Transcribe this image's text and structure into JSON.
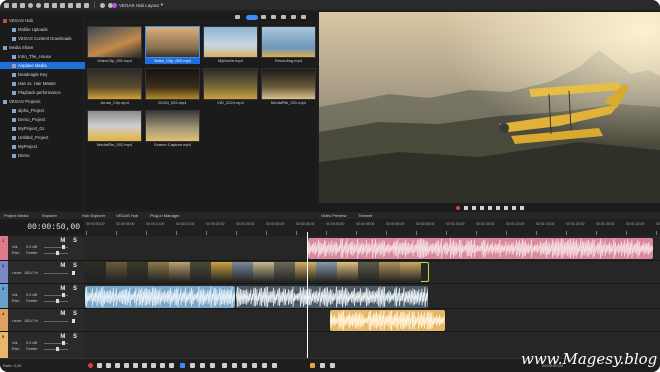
{
  "app": {
    "layout_title": "VEGAS Hub Layout",
    "accent": "#3b8cff",
    "brand": "#b25ad6"
  },
  "toolbar_icons": [
    "new-icon",
    "open-icon",
    "save-icon",
    "settings-icon",
    "gear-icon",
    "render-icon",
    "project-icon",
    "cut-icon",
    "copy-icon",
    "paste-icon",
    "delete-icon",
    "undo-icon",
    "redo-icon",
    "tools-icon"
  ],
  "tree": {
    "items": [
      {
        "label": "VEGAS Hub",
        "indent": 0,
        "icon": "hub-icon"
      },
      {
        "label": "Mobile Uploads",
        "indent": 1,
        "icon": "folder-icon"
      },
      {
        "label": "VEGAS Content Downloads",
        "indent": 1,
        "icon": "folder-icon"
      },
      {
        "label": "Media Share",
        "indent": 0,
        "icon": "folder-icon"
      },
      {
        "label": "Intro_The_House",
        "indent": 1,
        "icon": "folder-icon"
      },
      {
        "label": "Airplane Media",
        "indent": 1,
        "icon": "folder-icon",
        "selected": true
      },
      {
        "label": "Deadeagle Key",
        "indent": 1,
        "icon": "folder-icon"
      },
      {
        "label": "Hair vs. Hair Master",
        "indent": 1,
        "icon": "folder-icon"
      },
      {
        "label": "Playback performance",
        "indent": 1,
        "icon": "folder-icon"
      },
      {
        "label": "VEGAS Projects",
        "indent": 0,
        "icon": "folder-icon"
      },
      {
        "label": "alpha_Project",
        "indent": 1,
        "icon": "project-icon"
      },
      {
        "label": "Demo_Project",
        "indent": 1,
        "icon": "project-icon"
      },
      {
        "label": "MyProject_01",
        "indent": 1,
        "icon": "project-icon"
      },
      {
        "label": "Untitled_Project",
        "indent": 1,
        "icon": "project-icon"
      },
      {
        "label": "MyProject",
        "indent": 1,
        "icon": "project-icon"
      },
      {
        "label": "Demo",
        "indent": 1,
        "icon": "project-icon"
      }
    ]
  },
  "media": [
    {
      "caption": "VideoClip_001.mp4",
      "scene": "dusk"
    },
    {
      "caption": "Video_Clip_002.mp4",
      "scene": "sunset",
      "selected": true
    },
    {
      "caption": "MyMovie.mp4",
      "scene": "sky"
    },
    {
      "caption": "Recording.mp4",
      "scene": "plane-sky"
    },
    {
      "caption": "Jenas_Clip.mp4",
      "scene": "hangar"
    },
    {
      "caption": "DCIM_003.mp4",
      "scene": "dark-plane"
    },
    {
      "caption": "VID_2024.mp4",
      "scene": "ground"
    },
    {
      "caption": "MediaFile_001.mp4",
      "scene": "pilot"
    },
    {
      "caption": "MediaFile_002.mp4",
      "scene": "plane-yellow"
    },
    {
      "caption": "Screen Capture.mp4",
      "scene": "hangar-light"
    }
  ],
  "tabs": [
    "Project Media",
    "Explorer",
    "Hub Explorer",
    "VEGAS Hub",
    "Plug-In Manager",
    "Video Preview",
    "Trimmer"
  ],
  "timeline": {
    "timecode": "00:00:50,00",
    "ruler": [
      "00:00:00;00",
      "00:00:05;00",
      "00:00:10;00",
      "00:00:15;00",
      "00:00:20;00",
      "00:00:25;00",
      "00:00:30;00",
      "00:00:35;00",
      "00:00:40;00",
      "00:00:45;00",
      "00:00:50;00",
      "00:00:55;00",
      "00:01:00;00",
      "00:01:05;00",
      "00:01:10;00",
      "00:01:15;00",
      "00:01:20;00",
      "00:01:25;00",
      "00:01:30;00",
      "00:01:35;00",
      "00:01:40;00"
    ],
    "tracks": [
      {
        "num": "1",
        "color": "#e07a8b",
        "type": "audio",
        "vol_label": "Vol:",
        "vol": "0,0 dB",
        "pan_label": "Pan:",
        "pan": "Center"
      },
      {
        "num": "2",
        "color": "#7a88c8",
        "type": "video",
        "level_label": "Level:",
        "level": "100,0 %"
      },
      {
        "num": "3",
        "color": "#6aa0d0",
        "type": "audio",
        "vol_label": "Vol:",
        "vol": "0,0 dB",
        "pan_label": "Pan:",
        "pan": "Center"
      },
      {
        "num": "4",
        "color": "#e0a060",
        "type": "video",
        "level_label": "Level:",
        "level": "100,0 %"
      },
      {
        "num": "5",
        "color": "#e8b86a",
        "type": "audio",
        "vol_label": "Vol:",
        "vol": "0,0 dB",
        "pan_label": "Pan:",
        "pan": "Center"
      }
    ],
    "mute_solo": "M S"
  },
  "status": {
    "rate": "Rate: 0,00",
    "record_time": "00:00:50,00"
  },
  "watermark": "www.Magesy.blog"
}
